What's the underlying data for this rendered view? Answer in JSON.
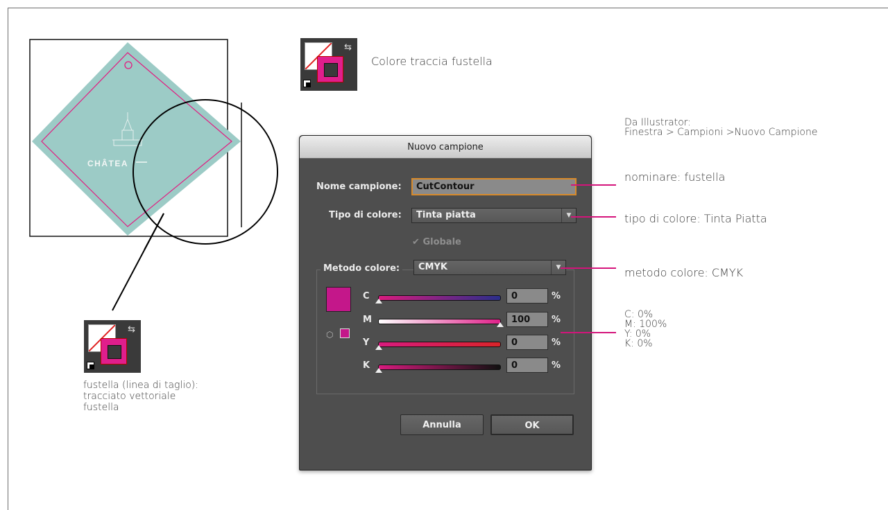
{
  "artwork": {
    "tag_brand": "CHÂTEA"
  },
  "well_top": {
    "label": "Colore traccia fustella"
  },
  "well_bottom": {
    "label_lines": [
      "fustella (linea di taglio):",
      "tracciato vettoriale",
      "fustella"
    ]
  },
  "source_note": {
    "lines": [
      "Da Illustrator:",
      "Finestra > Campioni >Nuovo Campione"
    ]
  },
  "dialog": {
    "title": "Nuovo campione",
    "name_label": "Nome campione:",
    "name_value": "CutContour",
    "type_label": "Tipo di colore:",
    "type_value": "Tinta piatta",
    "global_label": "Globale",
    "mode_label": "Metodo colore:",
    "mode_value": "CMYK",
    "channels": [
      {
        "label": "C",
        "value": "0",
        "unit": "%",
        "gradient_start": "#d81b7e",
        "gradient_end": "#2a2e8a",
        "level": 0
      },
      {
        "label": "M",
        "value": "100",
        "unit": "%",
        "gradient_start": "#ffffff",
        "gradient_end": "#e0218a",
        "level": 1
      },
      {
        "label": "Y",
        "value": "0",
        "unit": "%",
        "gradient_start": "#d81b7e",
        "gradient_end": "#d9242a",
        "level": 0
      },
      {
        "label": "K",
        "value": "0",
        "unit": "%",
        "gradient_start": "#d81b7e",
        "gradient_end": "#111111",
        "level": 0
      }
    ],
    "preview_color": "#c4178a",
    "cancel_label": "Annulla",
    "ok_label": "OK"
  },
  "annotations": {
    "name": "nominare: fustella",
    "type": "tipo di colore: Tinta Piatta",
    "mode": "metodo colore: CMYK",
    "cmyk": [
      "C: 0%",
      "M: 100%",
      "Y: 0%",
      "K: 0%"
    ]
  },
  "colors": {
    "accent": "#d4147b",
    "tag": "#9ccbc6",
    "die_line": "#e3197f"
  }
}
